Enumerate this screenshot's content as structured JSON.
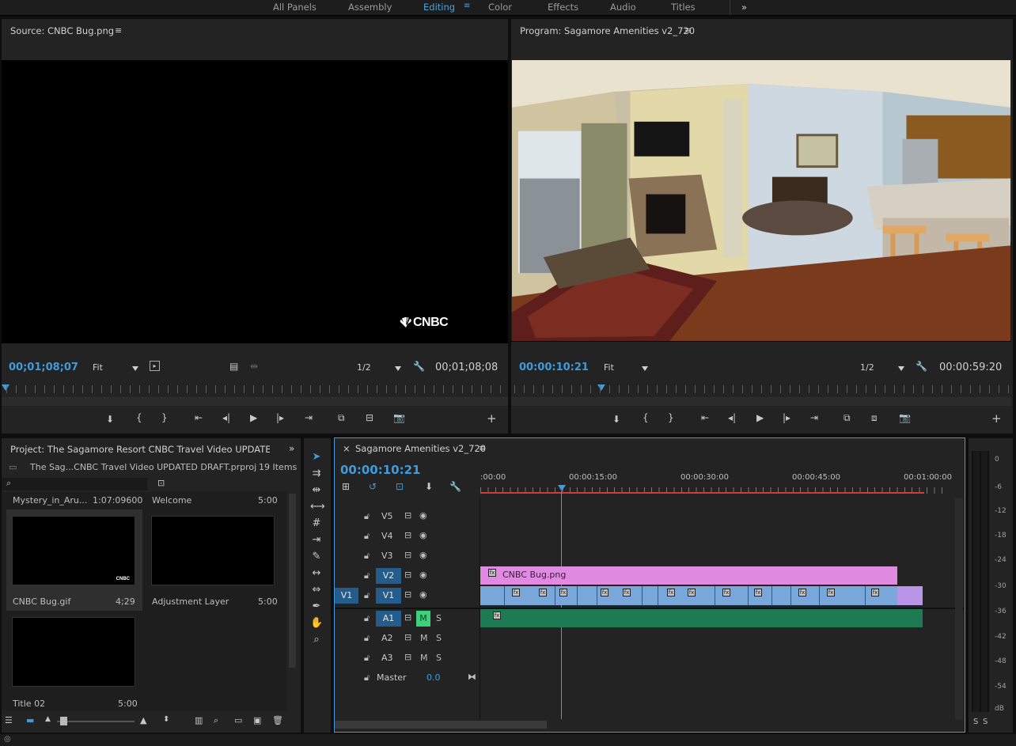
{
  "workspaces": [
    "All Panels",
    "Assembly",
    "Editing",
    "Color",
    "Effects",
    "Audio",
    "Titles"
  ],
  "workspace_active": "Editing",
  "workspace_more": "»",
  "source": {
    "title": "Source: CNBC Bug.png",
    "menu": "≡",
    "logo_text": "CNBC",
    "timecode_left": "00;01;08;07",
    "fit": "Fit",
    "res": "1/2",
    "timecode_right": "00;01;08;08"
  },
  "program": {
    "title": "Program: Sagamore Amenities v2_720",
    "menu": "≡",
    "timecode_left": "00:00:10:21",
    "fit": "Fit",
    "res": "1/2",
    "timecode_right": "00:00:59:20"
  },
  "project": {
    "title": "Project: The Sagamore Resort CNBC Travel Video UPDATED DRA",
    "expand": "»",
    "file": "The Sag...CNBC Travel Video UPDATED DRAFT.prproj",
    "count": "19 Items",
    "items": [
      {
        "name": "Mystery_in_Aru...",
        "duration": "1:07:09600"
      },
      {
        "name": "Welcome",
        "duration": "5:00"
      },
      {
        "name": "CNBC Bug.gif",
        "duration": "4;29"
      },
      {
        "name": "Adjustment Layer",
        "duration": "5:00"
      },
      {
        "name": "Title 02",
        "duration": "5:00"
      }
    ],
    "thumb_logo": "CNBC"
  },
  "timeline": {
    "close": "×",
    "title": "Sagamore Amenities v2_720",
    "menu": "≡",
    "timecode": "00:00:10:21",
    "ruler_labels": [
      ":00:00",
      "00:00:15:00",
      "00:00:30:00",
      "00:00:45:00",
      "00:01:00:00"
    ],
    "video_tracks": [
      "V5",
      "V4",
      "V3",
      "V2",
      "V1"
    ],
    "audio_tracks": [
      "A1",
      "A2",
      "A3"
    ],
    "source_patch_v": "V1",
    "mute": "M",
    "solo": "S",
    "master_label": "Master",
    "master_value": "0.0",
    "v2_clip": "CNBC Bug.png",
    "fx": "fx"
  },
  "meter": {
    "labels": [
      "0",
      "-6",
      "-12",
      "-18",
      "-24",
      "-30",
      "-36",
      "-42",
      "-48",
      "-54",
      "dB"
    ],
    "solo_left": "S",
    "solo_right": "S"
  },
  "colors": {
    "accent": "#3f9bdb",
    "clip_pink": "#e18ae1",
    "clip_blue": "#7aa7d9",
    "clip_green": "#1d7a52"
  }
}
